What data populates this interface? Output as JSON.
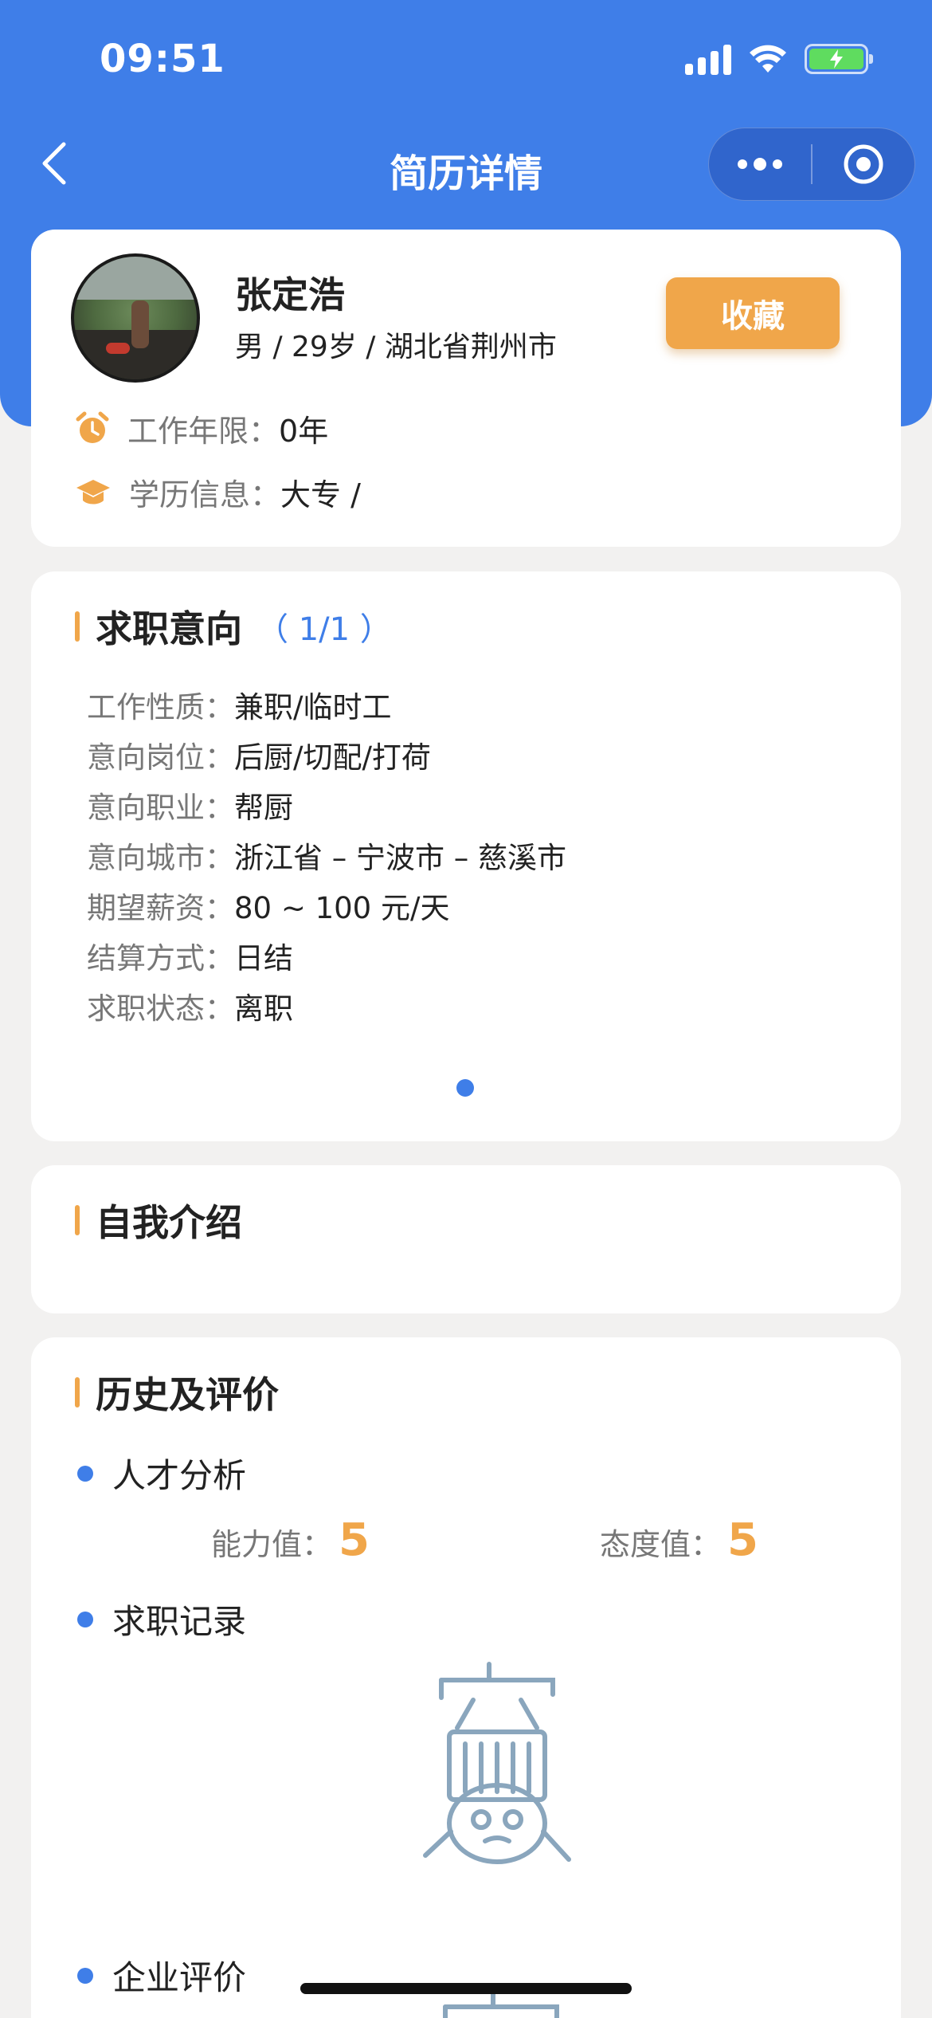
{
  "status_bar": {
    "time": "09:51"
  },
  "nav": {
    "title": "简历详情"
  },
  "profile": {
    "name": "张定浩",
    "meta": "男 / 29岁 / 湖北省荆州市",
    "favorite_label": "收藏",
    "work_years_label": "工作年限：",
    "work_years_value": "0年",
    "education_label": "学历信息：",
    "education_value": "大专 /"
  },
  "intent": {
    "title": "求职意向",
    "count": "（ 1/1 ）",
    "rows": [
      {
        "k": "工作性质：",
        "v": "兼职/临时工"
      },
      {
        "k": "意向岗位：",
        "v": "后厨/切配/打荷"
      },
      {
        "k": "意向职业：",
        "v": "帮厨"
      },
      {
        "k": "意向城市：",
        "v": "浙江省 – 宁波市 – 慈溪市"
      },
      {
        "k": "期望薪资：",
        "v": "80 ~ 100 元/天"
      },
      {
        "k": "结算方式：",
        "v": "日结"
      },
      {
        "k": "求职状态：",
        "v": "离职"
      }
    ]
  },
  "self_intro": {
    "title": "自我介绍"
  },
  "history": {
    "title": "历史及评价",
    "talent_analysis": "人才分析",
    "ability_label": "能力值：",
    "ability_value": "5",
    "attitude_label": "态度值：",
    "attitude_value": "5",
    "job_records": "求职记录",
    "company_reviews": "企业评价"
  },
  "colors": {
    "primary": "#3f7ee8",
    "accent": "#f0a64a"
  },
  "icons": [
    "back-arrow-icon",
    "more-dots-icon",
    "target-icon",
    "alarm-clock-icon",
    "graduation-cap-icon",
    "empty-state-icon"
  ]
}
